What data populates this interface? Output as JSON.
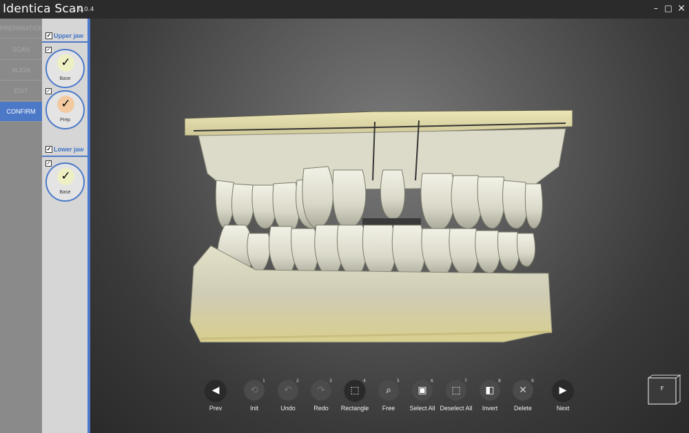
{
  "app": {
    "title": "Identica Scan",
    "version": "1.0.0.4"
  },
  "window_controls": {
    "minimize": "–",
    "maximize": "□",
    "close": "×"
  },
  "steps": [
    {
      "label": "PREPARATION",
      "active": false
    },
    {
      "label": "SCAN",
      "active": false
    },
    {
      "label": "ALIGN",
      "active": false
    },
    {
      "label": "EDIT",
      "active": false
    },
    {
      "label": "CONFIRM",
      "active": true
    }
  ],
  "jaws": {
    "upper": {
      "label": "Upper jaw",
      "checked": true,
      "scans": [
        {
          "name": "Base",
          "checked": true,
          "color": "#eef0c4"
        },
        {
          "name": "Prep",
          "checked": true,
          "color": "#f2c9a0"
        }
      ]
    },
    "lower": {
      "label": "Lower jaw",
      "checked": true,
      "scans": [
        {
          "name": "Base",
          "checked": true,
          "color": "#eef0c4"
        }
      ]
    }
  },
  "toolbar": [
    {
      "label": "Prev",
      "badge": "",
      "icon": "prev-arrow-icon",
      "enabled": true
    },
    {
      "label": "Init",
      "badge": "1",
      "icon": "reset-icon",
      "enabled": false
    },
    {
      "label": "Undo",
      "badge": "2",
      "icon": "undo-icon",
      "enabled": false
    },
    {
      "label": "Redo",
      "badge": "3",
      "icon": "redo-icon",
      "enabled": false
    },
    {
      "label": "Rectangle",
      "badge": "4",
      "icon": "rectangle-select-icon",
      "enabled": true
    },
    {
      "label": "Free",
      "badge": "5",
      "icon": "lasso-select-icon",
      "enabled": true
    },
    {
      "label": "Select All",
      "badge": "6",
      "icon": "select-all-icon",
      "enabled": true
    },
    {
      "label": "Deselect All",
      "badge": "7",
      "icon": "deselect-all-icon",
      "enabled": true
    },
    {
      "label": "Invert",
      "badge": "8",
      "icon": "invert-selection-icon",
      "enabled": true
    },
    {
      "label": "Delete",
      "badge": "9",
      "icon": "delete-icon",
      "enabled": true
    },
    {
      "label": "Next",
      "badge": "",
      "icon": "next-arrow-icon",
      "enabled": true
    }
  ],
  "view_cube": {
    "face": "F"
  },
  "colors": {
    "accent": "#4c78c8",
    "model": "#d8d6c4",
    "model_gum": "#d4c98a"
  }
}
